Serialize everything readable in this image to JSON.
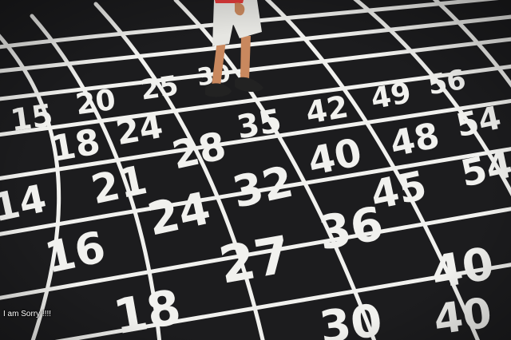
{
  "scene": {
    "colors": {
      "asphalt": "#1c1c1e",
      "chalk": "#f1f1ee",
      "skin": "#c9885e",
      "shorts": "#e6e6e2",
      "shirt": "#e23b3b",
      "sandal": "#222222"
    },
    "numbers": [
      {
        "value": "15"
      },
      {
        "value": "20"
      },
      {
        "value": "25"
      },
      {
        "value": "30"
      },
      {
        "value": "18"
      },
      {
        "value": "24"
      },
      {
        "value": "35"
      },
      {
        "value": "42"
      },
      {
        "value": "49"
      },
      {
        "value": "56"
      },
      {
        "value": "14"
      },
      {
        "value": "21"
      },
      {
        "value": "28"
      },
      {
        "value": "40"
      },
      {
        "value": "48"
      },
      {
        "value": "54"
      },
      {
        "value": "16"
      },
      {
        "value": "24"
      },
      {
        "value": "32"
      },
      {
        "value": "45"
      },
      {
        "value": "54"
      },
      {
        "value": "18"
      },
      {
        "value": "27"
      },
      {
        "value": "36"
      },
      {
        "value": "40"
      },
      {
        "value": "30"
      },
      {
        "value": "40"
      }
    ]
  },
  "caption": "I am Sorry !!!!"
}
